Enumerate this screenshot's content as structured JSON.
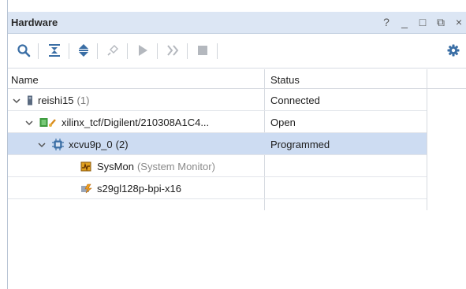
{
  "panel": {
    "title": "Hardware",
    "window_controls": {
      "help": "?",
      "minimize": "_",
      "maximize": "□",
      "float": "⧉",
      "close": "×"
    }
  },
  "toolbar": {
    "icons": [
      "search-icon",
      "collapse-all-icon",
      "expand-all-icon",
      "disconnect-icon",
      "run-icon",
      "forward-icon",
      "stop-icon",
      "gear-icon"
    ]
  },
  "table": {
    "columns": {
      "name": "Name",
      "status": "Status"
    },
    "rows": [
      {
        "label": "reishi15",
        "count": "(1)",
        "status": "Connected"
      },
      {
        "label": "xilinx_tcf/Digilent/210308A1C4...",
        "status": "Open"
      },
      {
        "label": "xcvu9p_0",
        "count": "(2)",
        "status": "Programmed"
      },
      {
        "label": "SysMon",
        "sub": "(System Monitor)",
        "status": ""
      },
      {
        "label": "s29gl128p-bpi-x16",
        "status": ""
      }
    ]
  },
  "colors": {
    "title_bg": "#dce6f4",
    "selection": "#cddcf2",
    "accent_blue": "#3a6ea5"
  }
}
